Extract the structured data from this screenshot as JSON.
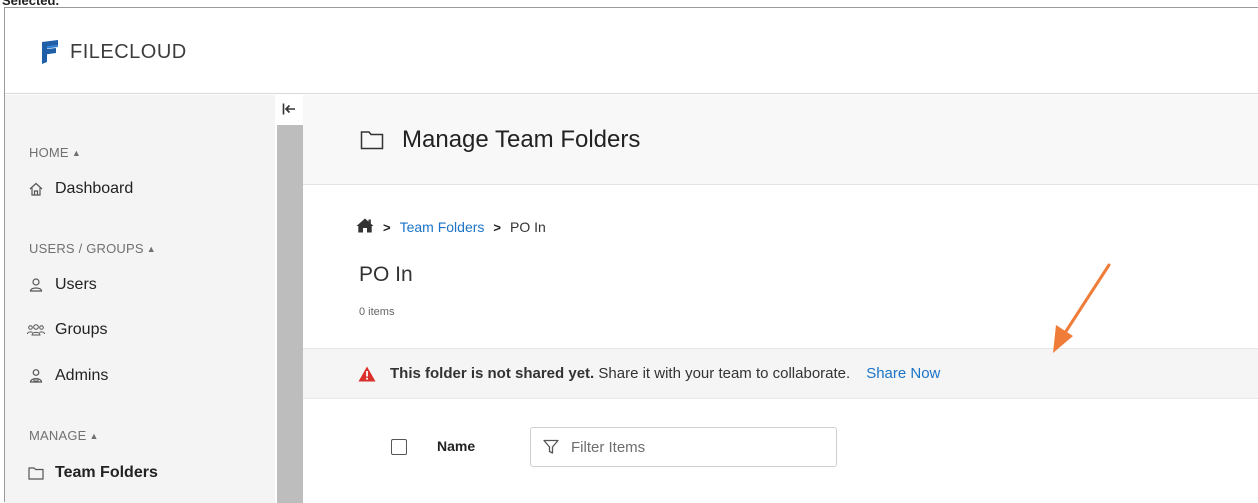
{
  "page_caption": "Selected.",
  "brand": {
    "name": "FILECLOUD"
  },
  "sidebar": {
    "sections": [
      {
        "label": "HOME",
        "items": [
          {
            "label": "Dashboard",
            "icon": "home-icon"
          }
        ]
      },
      {
        "label": "USERS / GROUPS",
        "items": [
          {
            "label": "Users",
            "icon": "user-icon"
          },
          {
            "label": "Groups",
            "icon": "groups-icon"
          },
          {
            "label": "Admins",
            "icon": "admin-icon"
          }
        ]
      },
      {
        "label": "MANAGE",
        "items": [
          {
            "label": "Team Folders",
            "icon": "folder-icon"
          }
        ]
      }
    ],
    "collapse_icon": "collapse-sidebar-icon"
  },
  "header": {
    "title": "Manage Team Folders",
    "icon": "folder-icon"
  },
  "breadcrumb": {
    "home_icon": "home-icon",
    "items": [
      "Team Folders",
      "PO In"
    ]
  },
  "folder": {
    "name": "PO In",
    "count": "0 items"
  },
  "alert": {
    "bold": "This folder is not shared yet.",
    "text": "Share it with your team to collaborate.",
    "action": "Share Now",
    "icon": "warning-icon",
    "icon_color": "#d9302c"
  },
  "list": {
    "column_name": "Name",
    "filter_placeholder": "Filter Items",
    "filter_icon": "filter-icon"
  },
  "colors": {
    "link": "#1b74c8",
    "annotation_arrow": "#f07c3a"
  }
}
